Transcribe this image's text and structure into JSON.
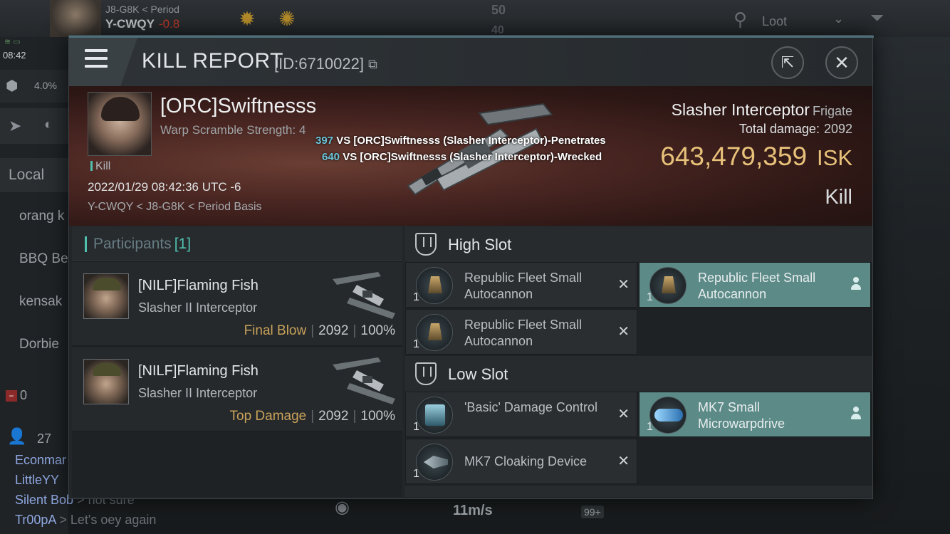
{
  "hud": {
    "system_path": "J8-G8K",
    "constellation": "Period",
    "current_system": "Y-CWQY",
    "security": "-0.8",
    "clock": "08:42",
    "cargo_percent": "4.0%",
    "speed_scale_1": "50",
    "speed_scale_2": "40",
    "loot_filter": "Loot",
    "chat_tab": "Local",
    "local_members": [
      "orang k",
      "BBQ Be",
      "kensak",
      "Dorbie"
    ],
    "local_minus": "0",
    "people_count": "27",
    "chat_lines": [
      {
        "name": "Econmar",
        "msg": ""
      },
      {
        "name": "LittleYY",
        "msg": ""
      },
      {
        "name": "Silent Bob",
        "msg": " > not sure"
      },
      {
        "name": "Tr00pA",
        "msg": " > Let's oey again"
      }
    ],
    "bottom_speed": "11m/s",
    "bottom_badge": "99+"
  },
  "modal": {
    "title": "KILL REPORT",
    "id_label": "[ID:6710022]",
    "victim": {
      "name": "[ORC]Swiftnesss",
      "warp_scramble": "Warp Scramble Strength: 4",
      "tag": "Kill",
      "datetime": "2022/01/29 08:42:36 UTC -6",
      "location": "Y-CWQY < J8-G8K < Period Basis"
    },
    "damage_lines": [
      {
        "num": "397",
        "text": " VS [ORC]Swiftnesss (Slasher Interceptor)-Penetrates"
      },
      {
        "num": "640",
        "text": " VS [ORC]Swiftnesss (Slasher Interceptor)-Wrecked"
      }
    ],
    "ship": {
      "name": "Slasher Interceptor",
      "class": "Frigate",
      "total_damage_label": "Total damage:",
      "total_damage": "2092",
      "isk_value": "643,479,359",
      "isk_unit": "ISK",
      "result": "Kill"
    },
    "participants": {
      "title": "Participants",
      "count": "[1]",
      "rows": [
        {
          "name": "[NILF]Flaming Fish",
          "ship": "Slasher II Interceptor",
          "role": "Final Blow",
          "damage": "2092",
          "percent": "100%"
        },
        {
          "name": "[NILF]Flaming Fish",
          "ship": "Slasher II Interceptor",
          "role": "Top Damage",
          "damage": "2092",
          "percent": "100%"
        }
      ]
    },
    "fitting": {
      "high_slot_title": "High Slot",
      "low_slot_title": "Low Slot",
      "high_items": [
        {
          "qty": "1",
          "name": "Republic Fleet Small Autocannon",
          "status": "destroyed",
          "icon": "autocannon-icon"
        },
        {
          "qty": "1",
          "name": "Republic Fleet Small Autocannon",
          "status": "dropped",
          "icon": "autocannon-icon"
        },
        {
          "qty": "1",
          "name": "Republic Fleet Small Autocannon",
          "status": "destroyed",
          "icon": "autocannon-icon"
        }
      ],
      "low_items": [
        {
          "qty": "1",
          "name": "'Basic' Damage Control",
          "status": "destroyed",
          "icon": "damage-control-icon"
        },
        {
          "qty": "1",
          "name": "MK7 Small Microwarpdrive",
          "status": "dropped",
          "icon": "microwarpdrive-icon"
        },
        {
          "qty": "1",
          "name": "MK7 Cloaking Device",
          "status": "destroyed",
          "icon": "cloaking-device-icon"
        }
      ]
    }
  },
  "colors": {
    "accent_teal": "#4fbfae",
    "isk_gold": "#e8c27a",
    "dropped_bg": "#5b8a87",
    "role_gold": "#c9a25a",
    "damage_num": "#6bc4d8"
  }
}
